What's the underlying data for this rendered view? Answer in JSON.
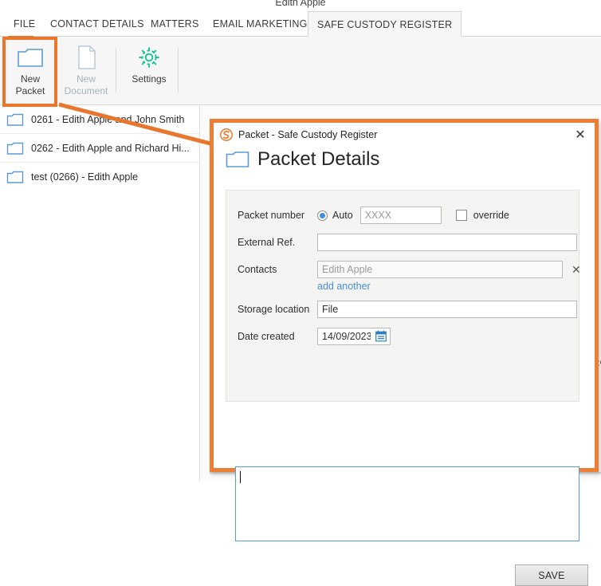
{
  "window": {
    "top_label": "Edith Apple"
  },
  "tabs": [
    {
      "label": "FILE",
      "active": false
    },
    {
      "label": "CONTACT DETAILS",
      "active": false
    },
    {
      "label": "MATTERS",
      "active": false
    },
    {
      "label": "EMAIL MARKETING",
      "active": false
    },
    {
      "label": "SAFE CUSTODY REGISTER",
      "active": true
    }
  ],
  "ribbon": {
    "buttons": [
      {
        "line1": "New",
        "line2": "Packet",
        "icon": "folder-icon",
        "disabled": false
      },
      {
        "line1": "New",
        "line2": "Document",
        "icon": "document-icon",
        "disabled": true
      },
      {
        "line1": "Settings",
        "line2": "",
        "icon": "gear-icon",
        "disabled": false
      }
    ]
  },
  "packet_list": [
    {
      "icon": "folder-icon",
      "text": "0261  -  Edith Apple and John Smith"
    },
    {
      "icon": "folder-icon",
      "text": "0262  -  Edith Apple and Richard Hi..."
    },
    {
      "icon": "folder-icon",
      "text": "test (0266)  -  Edith Apple"
    }
  ],
  "dialog": {
    "title": "Packet - Safe Custody Register",
    "logo_icon": "smokeball-logo-icon",
    "close_icon": "close-icon",
    "heading": "Packet Details",
    "heading_icon": "folder-icon",
    "fields": {
      "packet_number": {
        "label": "Packet number",
        "auto_label": "Auto",
        "auto_selected": true,
        "number_value": "",
        "number_placeholder": "XXXX",
        "override_label": "override",
        "override_checked": false
      },
      "external_ref": {
        "label": "External Ref.",
        "value": "",
        "placeholder": ""
      },
      "contacts": {
        "label": "Contacts",
        "value": "",
        "placeholder": "Edith Apple",
        "remove_icon": "close-icon",
        "add_another_label": "add another"
      },
      "storage_location": {
        "label": "Storage location",
        "value": "File",
        "placeholder": ""
      },
      "date_created": {
        "label": "Date created",
        "value": "14/09/2023",
        "picker_icon": "calendar-icon"
      },
      "notes": {
        "value": "",
        "placeholder": ""
      }
    },
    "save_label": "SAVE"
  },
  "annotation": {
    "color": "#e8762c",
    "highlight_target": "new-packet-button",
    "arrow_from": "new-packet-button",
    "arrow_to": "packet-details-dialog"
  },
  "edge_fragment": {
    "text": ":C"
  },
  "colors": {
    "accent_orange": "#e8762c",
    "dialog_border": "#ec7f33",
    "folder_blue": "#5b9bd5",
    "gear_teal": "#18c39a",
    "link_blue": "#4a8fd4",
    "radio_blue": "#3f8fdc",
    "ribbon_bg": "#f6f6f6",
    "panel_bg": "#f4f4f2"
  }
}
